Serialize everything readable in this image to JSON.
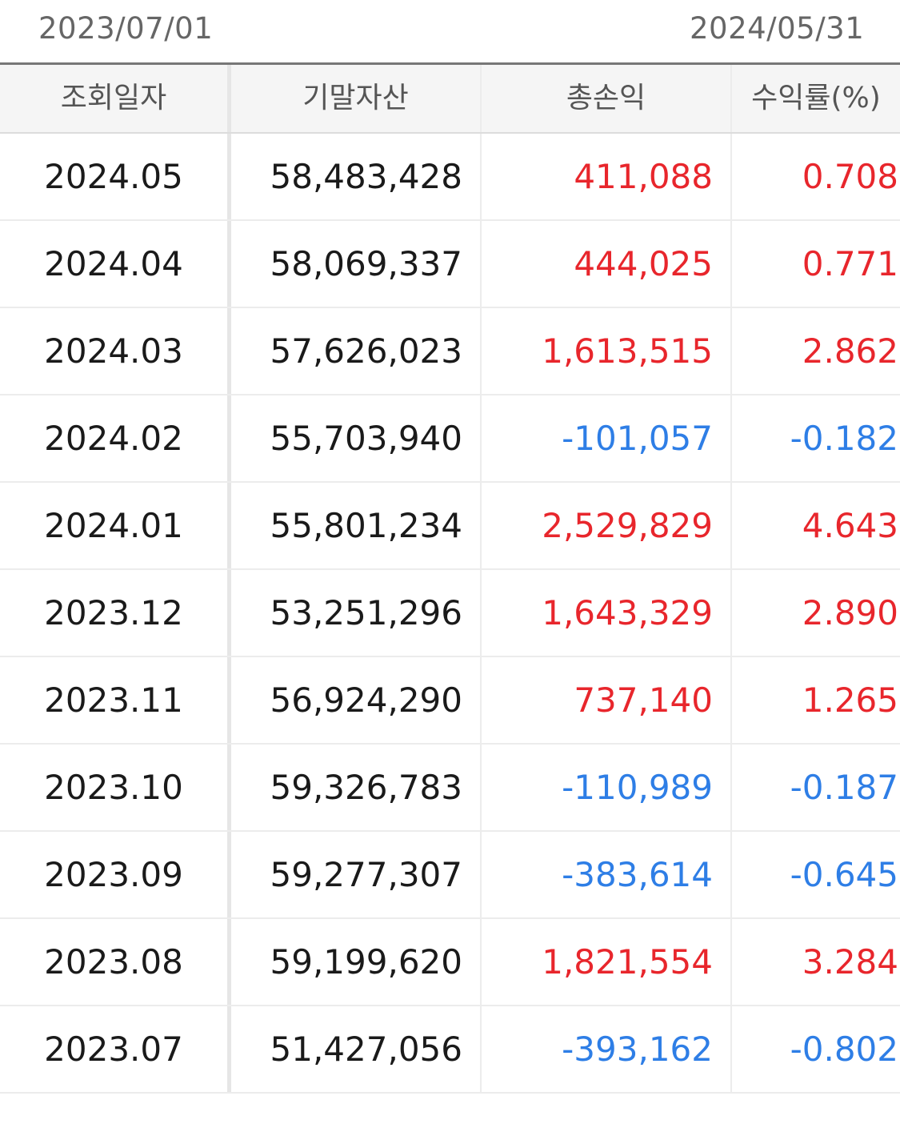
{
  "date_range": {
    "start": "2023/07/01",
    "end": "2024/05/31"
  },
  "table": {
    "headers": [
      "조회일자",
      "기말자산",
      "총손익",
      "수익률(%)"
    ],
    "rows": [
      {
        "date": "2024.05",
        "assets": "58,483,428",
        "pnl": "411,088",
        "return_pct": "0.708",
        "sign": "pos"
      },
      {
        "date": "2024.04",
        "assets": "58,069,337",
        "pnl": "444,025",
        "return_pct": "0.771",
        "sign": "pos"
      },
      {
        "date": "2024.03",
        "assets": "57,626,023",
        "pnl": "1,613,515",
        "return_pct": "2.862",
        "sign": "pos"
      },
      {
        "date": "2024.02",
        "assets": "55,703,940",
        "pnl": "-101,057",
        "return_pct": "-0.182",
        "sign": "neg"
      },
      {
        "date": "2024.01",
        "assets": "55,801,234",
        "pnl": "2,529,829",
        "return_pct": "4.643",
        "sign": "pos"
      },
      {
        "date": "2023.12",
        "assets": "53,251,296",
        "pnl": "1,643,329",
        "return_pct": "2.890",
        "sign": "pos"
      },
      {
        "date": "2023.11",
        "assets": "56,924,290",
        "pnl": "737,140",
        "return_pct": "1.265",
        "sign": "pos"
      },
      {
        "date": "2023.10",
        "assets": "59,326,783",
        "pnl": "-110,989",
        "return_pct": "-0.187",
        "sign": "neg"
      },
      {
        "date": "2023.09",
        "assets": "59,277,307",
        "pnl": "-383,614",
        "return_pct": "-0.645",
        "sign": "neg"
      },
      {
        "date": "2023.08",
        "assets": "59,199,620",
        "pnl": "1,821,554",
        "return_pct": "3.284",
        "sign": "pos"
      },
      {
        "date": "2023.07",
        "assets": "51,427,056",
        "pnl": "-393,162",
        "return_pct": "-0.802",
        "sign": "neg"
      }
    ]
  },
  "colors": {
    "positive": "#e8262c",
    "negative": "#2e7ee6",
    "text": "#1a1a1a",
    "header_bg": "#f5f5f5"
  }
}
